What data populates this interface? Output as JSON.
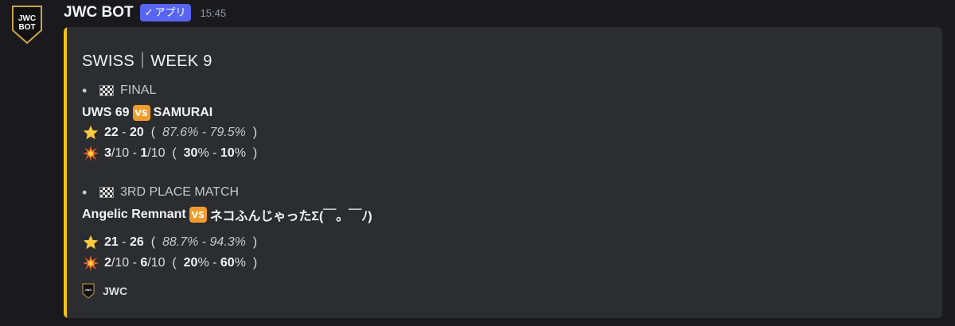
{
  "message": {
    "username": "JWC BOT",
    "badge_check": "✓",
    "badge_label": "アプリ",
    "timestamp": "15:45",
    "avatar_text_1": "JWC",
    "avatar_text_2": "BOT"
  },
  "embed": {
    "accent_color": "#f1c40f",
    "title": "SWISS｜WEEK 9",
    "matches": [
      {
        "bullet": "•",
        "stage": "FINAL",
        "team_a": "UWS 69",
        "vs": "VS",
        "team_b": "SAMURAI",
        "score_a": "22",
        "score_sep": "-",
        "score_b": "20",
        "pct_text": "87.6% - 79.5%",
        "boom_a": "3",
        "boom_a_total": "/10",
        "boom_b": "1",
        "boom_b_total": "/10",
        "boom_pct_a": "30",
        "boom_pct_b": "10"
      },
      {
        "bullet": "•",
        "stage": "3RD PLACE MATCH",
        "team_a": "Angelic Remnant",
        "vs": "VS",
        "team_b": "ネコふんじゃったΣ(￣。￣ﾉ)",
        "score_a": "21",
        "score_sep": "-",
        "score_b": "26",
        "pct_text": "88.7% - 94.3%",
        "boom_a": "2",
        "boom_a_total": "/10",
        "boom_b": "6",
        "boom_b_total": "/10",
        "boom_pct_a": "20",
        "boom_pct_b": "60"
      }
    ],
    "footer_text": "JWC",
    "footer_icon_text": "JWC"
  },
  "icons": {
    "stage": "checkered-flag-icon",
    "vs": "vs-icon",
    "score": "star-icon",
    "hits": "collision-icon"
  }
}
